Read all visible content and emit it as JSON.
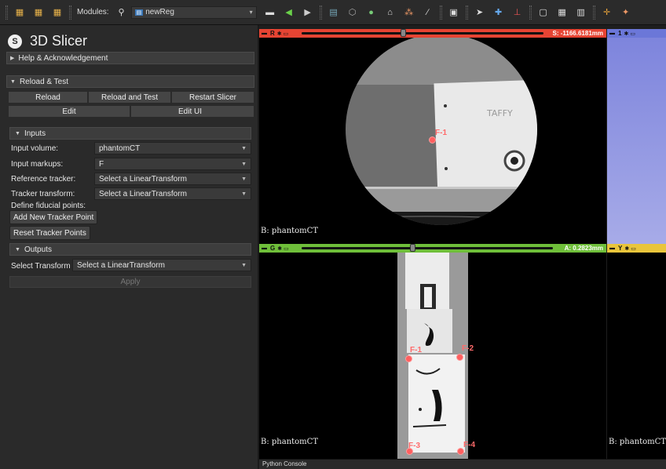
{
  "toolbar": {
    "modules_label": "Modules:",
    "module_value": "newReg",
    "icons": [
      "dicom-icon",
      "data-icon",
      "save-icon",
      "search-icon",
      "layout-icon",
      "back-icon",
      "forward-icon",
      "segment-icon",
      "model-icon",
      "volume-icon",
      "home-icon",
      "markup-icon",
      "ruler-icon",
      "screenshot-icon",
      "pointer-icon",
      "fiducial-icon",
      "crosshair-icon"
    ]
  },
  "app": {
    "title": "3D Slicer"
  },
  "sections": {
    "help": "Help & Acknowledgement",
    "reload": "Reload & Test",
    "inputs": "Inputs",
    "outputs": "Outputs"
  },
  "reload_buttons": {
    "reload": "Reload",
    "reload_test": "Reload and Test",
    "restart": "Restart Slicer",
    "edit": "Edit",
    "edit_ui": "Edit UI"
  },
  "inputs": {
    "input_volume_label": "Input volume:",
    "input_volume_value": "phantomCT",
    "input_markups_label": "Input markups:",
    "input_markups_value": "F",
    "reference_tracker_label": "Reference tracker:",
    "reference_tracker_value": "Select a LinearTransform",
    "tracker_transform_label": "Tracker transform:",
    "tracker_transform_value": "Select a LinearTransform",
    "define_label": "Define fiducial points:",
    "add_point": "Add New Tracker Point",
    "reset_points": "Reset Tracker Points"
  },
  "outputs": {
    "select_label": "Select Transform",
    "select_value": "Select a LinearTransform",
    "apply": "Apply"
  },
  "views": {
    "red": {
      "letter": "R",
      "offset": "S: -1166.6181mm",
      "label": "B: phantomCT",
      "slider": 0.42
    },
    "green": {
      "letter": "G",
      "offset": "A: 0.2823mm",
      "label": "B: phantomCT",
      "slider": 0.44
    },
    "yellow": {
      "letter": "Y",
      "label": "B: phantomCT"
    },
    "threed": {
      "letter": "1"
    }
  },
  "fiducials": {
    "red": [
      "F-1"
    ],
    "green": [
      "F-1",
      "F-2",
      "F-3",
      "F-4"
    ]
  },
  "status": {
    "python_console": "Python Console"
  }
}
